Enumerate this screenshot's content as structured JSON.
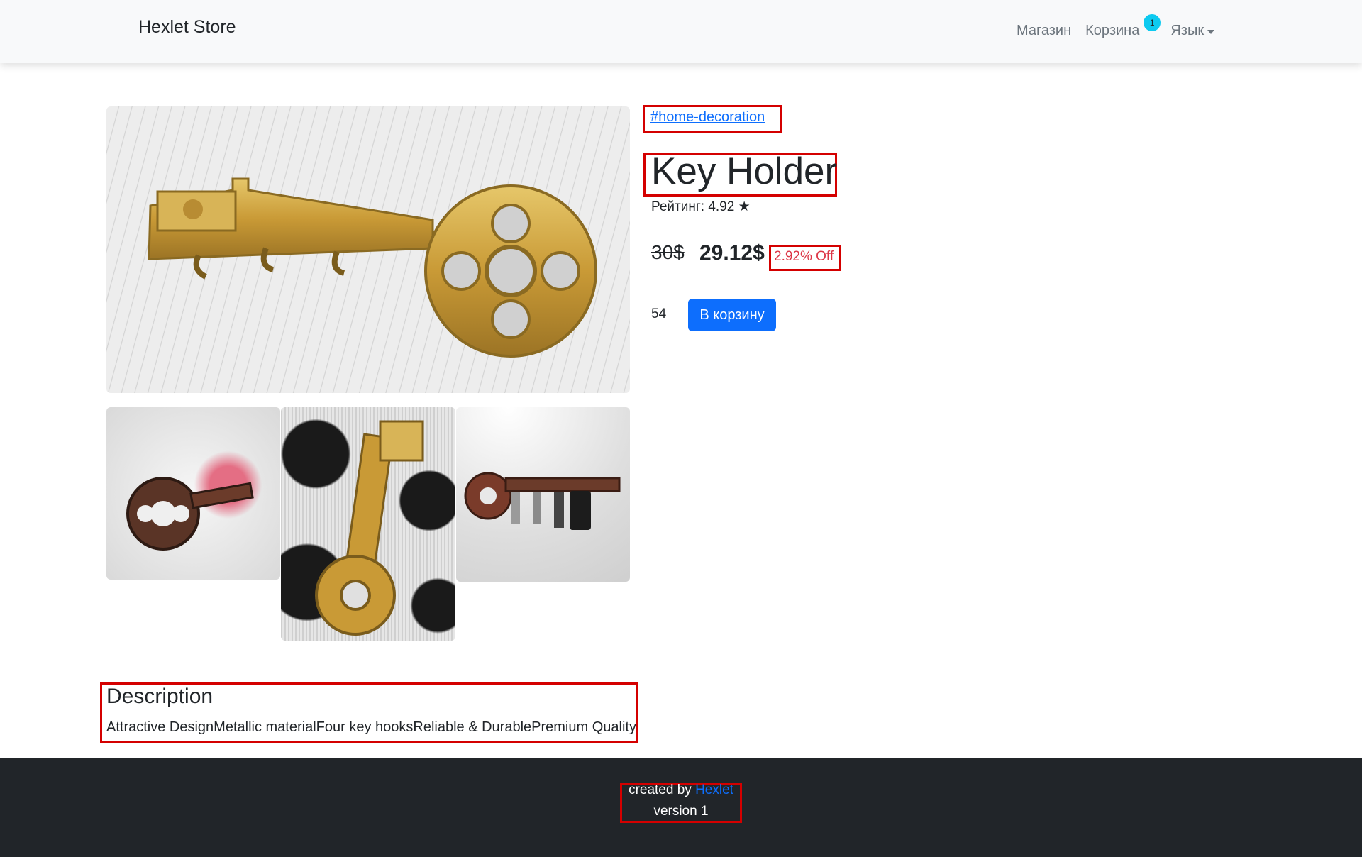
{
  "navbar": {
    "brand": "Hexlet Store",
    "links": {
      "shop": "Магазин",
      "cart": "Корзина",
      "language": "Язык"
    },
    "cart_badge": "1"
  },
  "product": {
    "tag": "#home-decoration",
    "title": "Key Holder",
    "rating": "Рейтинг: 4.92 ★",
    "old_price": "30$",
    "price": "29.12$",
    "discount": "2.92% Off",
    "stock": "54",
    "add_to_cart_label": "В корзину",
    "description_title": "Description",
    "description": "Attractive DesignMetallic materialFour key hooksReliable & DurablePremium Quality"
  },
  "footer": {
    "created_by": "created by ",
    "link": "Hexlet",
    "version": "version 1"
  },
  "colors": {
    "primary": "#0d6efd",
    "badge": "#0dcaf0",
    "discount": "#dc3545",
    "annotation": "#d40000",
    "footer_bg": "#212529"
  }
}
